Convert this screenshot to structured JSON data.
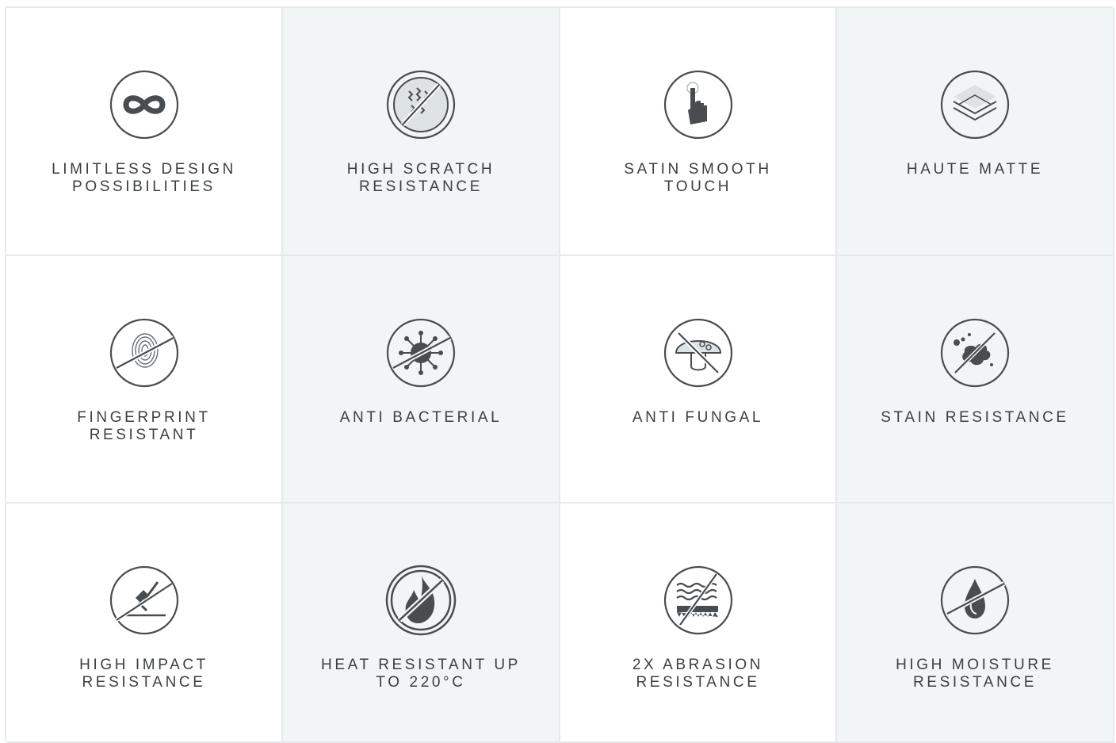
{
  "features": [
    {
      "label": "LIMITLESS DESIGN\nPOSSIBILITIES",
      "icon": "infinity-icon"
    },
    {
      "label": "HIGH SCRATCH\nRESISTANCE",
      "icon": "scratch-resistance-icon"
    },
    {
      "label": "SATIN SMOOTH\nTOUCH",
      "icon": "touch-finger-icon"
    },
    {
      "label": "HAUTE MATTE",
      "icon": "layers-icon"
    },
    {
      "label": "FINGERPRINT\nRESISTANT",
      "icon": "fingerprint-icon"
    },
    {
      "label": "ANTI BACTERIAL",
      "icon": "bacteria-icon"
    },
    {
      "label": "ANTI FUNGAL",
      "icon": "mushroom-icon"
    },
    {
      "label": "STAIN RESISTANCE",
      "icon": "stain-icon"
    },
    {
      "label": "HIGH IMPACT\nRESISTANCE",
      "icon": "hammer-icon"
    },
    {
      "label": "HEAT RESISTANT UP\nTO 220°C",
      "icon": "flame-icon"
    },
    {
      "label": "2X ABRASION\nRESISTANCE",
      "icon": "abrasion-icon"
    },
    {
      "label": "HIGH MOISTURE\nRESISTANCE",
      "icon": "water-drop-icon"
    }
  ],
  "colors": {
    "icon_stroke": "#4a4d50",
    "icon_fill": "#4a4d50",
    "shade_bg": "#f2f5f6",
    "border": "#e6e9ea",
    "text": "#3b3f42"
  }
}
